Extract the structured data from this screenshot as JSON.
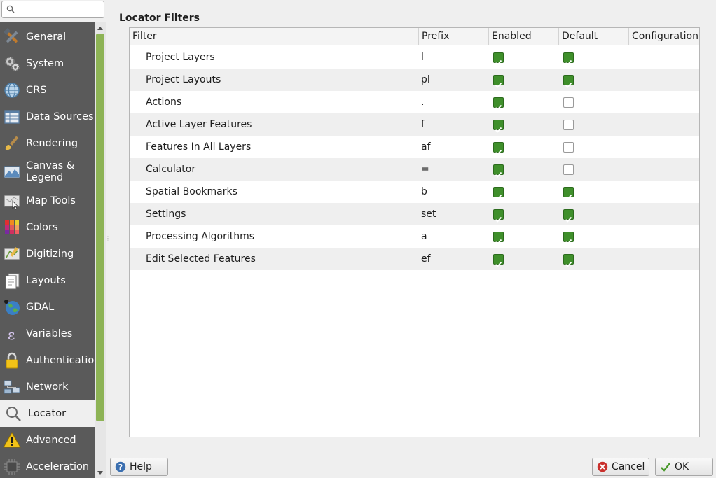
{
  "search": {
    "value": "",
    "placeholder": ""
  },
  "sidebar": {
    "items": [
      {
        "label": "General",
        "icon": "tools-icon"
      },
      {
        "label": "System",
        "icon": "gears-icon"
      },
      {
        "label": "CRS",
        "icon": "globe-grid-icon"
      },
      {
        "label": "Data Sources",
        "icon": "table-icon"
      },
      {
        "label": "Rendering",
        "icon": "paintbrush-icon"
      },
      {
        "label": "Canvas &\nLegend",
        "icon": "map-canvas-icon"
      },
      {
        "label": "Map Tools",
        "icon": "map-pointer-icon"
      },
      {
        "label": "Colors",
        "icon": "color-grid-icon"
      },
      {
        "label": "Digitizing",
        "icon": "digitizing-icon"
      },
      {
        "label": "Layouts",
        "icon": "layout-pages-icon"
      },
      {
        "label": "GDAL",
        "icon": "gdal-globe-icon"
      },
      {
        "label": "Variables",
        "icon": "epsilon-icon"
      },
      {
        "label": "Authentication",
        "icon": "padlock-icon"
      },
      {
        "label": "Network",
        "icon": "network-icon"
      },
      {
        "label": "Locator",
        "icon": "magnifier-icon",
        "selected": true
      },
      {
        "label": "Advanced",
        "icon": "warning-icon"
      },
      {
        "label": "Acceleration",
        "icon": "chip-icon"
      }
    ]
  },
  "main": {
    "section_title": "Locator Filters",
    "columns": [
      "Filter",
      "Prefix",
      "Enabled",
      "Default",
      "Configuration"
    ],
    "rows": [
      {
        "filter": "Project Layers",
        "prefix": "l",
        "enabled": true,
        "default": true
      },
      {
        "filter": "Project Layouts",
        "prefix": "pl",
        "enabled": true,
        "default": true
      },
      {
        "filter": "Actions",
        "prefix": ".",
        "enabled": true,
        "default": false
      },
      {
        "filter": "Active Layer Features",
        "prefix": "f",
        "enabled": true,
        "default": false
      },
      {
        "filter": "Features In All Layers",
        "prefix": "af",
        "enabled": true,
        "default": false
      },
      {
        "filter": "Calculator",
        "prefix": "=",
        "enabled": true,
        "default": false
      },
      {
        "filter": "Spatial Bookmarks",
        "prefix": "b",
        "enabled": true,
        "default": true
      },
      {
        "filter": "Settings",
        "prefix": "set",
        "enabled": true,
        "default": true
      },
      {
        "filter": "Processing Algorithms",
        "prefix": "a",
        "enabled": true,
        "default": true
      },
      {
        "filter": "Edit Selected Features",
        "prefix": "ef",
        "enabled": true,
        "default": true
      }
    ]
  },
  "buttons": {
    "help": "Help",
    "cancel": "Cancel",
    "ok": "OK"
  },
  "colors": {
    "sidebar_bg": "#5a5a5a",
    "scroll_thumb": "#8db355",
    "checkbox_on": "#3f8f2b"
  }
}
